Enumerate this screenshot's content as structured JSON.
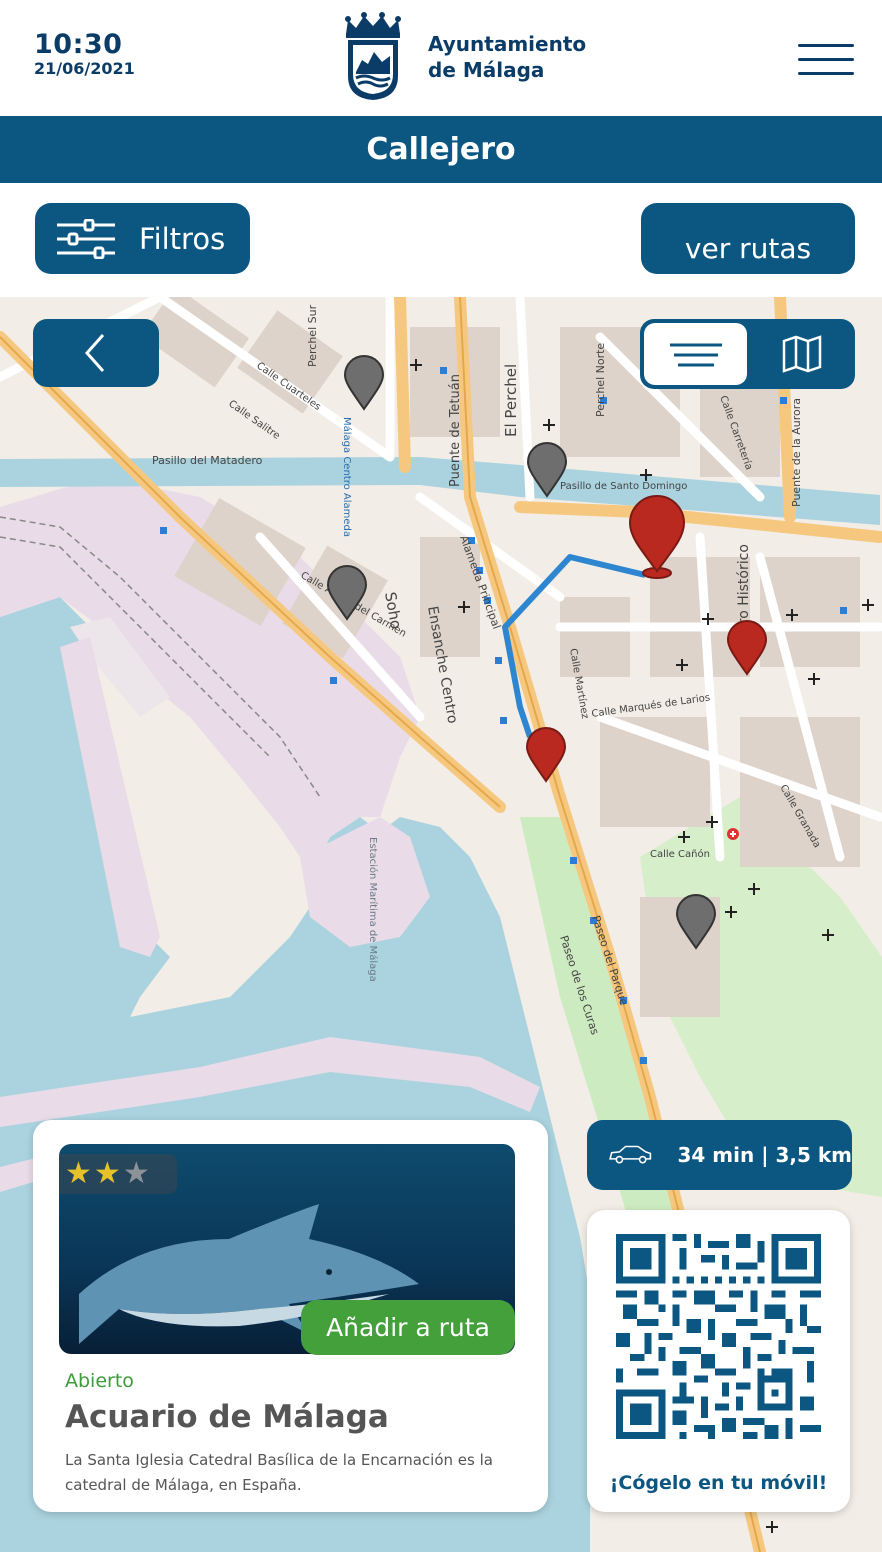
{
  "status_bar": {
    "time": "10:30",
    "date": "21/06/2021"
  },
  "header": {
    "brand_line1": "Ayuntamiento",
    "brand_line2": "de Málaga",
    "logo_icon": "malaga-coat-of-arms-icon",
    "menu_icon": "hamburger-menu-icon"
  },
  "title_bar": {
    "title": "Callejero"
  },
  "toolbar": {
    "filters_label": "Filtros",
    "filters_icon": "sliders-icon",
    "routes_label": "ver rutas"
  },
  "map_controls": {
    "back_icon": "chevron-left-icon",
    "list_view_icon": "list-icon",
    "map_view_icon": "map-icon",
    "selected_view": "list"
  },
  "map_labels": {
    "pasillo": "Pasillo del Matadero",
    "perchel_sur": "Perchel Sur",
    "el_perchel": "El Perchel",
    "perchel_norte": "Perchel Norte",
    "puente_tetuan": "Puente de Tetuán",
    "puente_aurora": "Puente de la Aurora",
    "alameda_principal": "Alameda Principal",
    "ensanche_centro": "Ensanche Centro",
    "soho": "Soho",
    "centro_historico": "Centro Histórico",
    "paseo_parque": "Paseo del Parque",
    "paseo_curas": "Paseo de los Curas",
    "estacion": "Estación Marítima de Málaga",
    "malaga_centro_alameda": "Málaga Centro Alameda",
    "calle_marques_larios": "Calle Marqués de Larios",
    "calle_granada": "Calle Granada",
    "calle_carreteria": "Calle Carretería",
    "calle_cuarteles": "Calle Cuarteles",
    "calle_salitre": "Calle Salitre",
    "calle_martinez": "Calle Martínez",
    "pasillo_santo_domingo": "Pasillo de Santo Domingo",
    "calle_ancha_carmen": "Calle Ancha del Carmen",
    "calle_canon": "Calle Cañón"
  },
  "route_info": {
    "icon": "car-icon",
    "text": "34 min | 3,5 km"
  },
  "place_card": {
    "rating": 2,
    "rating_max": 3,
    "photo_icon": "shark-photo",
    "add_button": "Añadir a ruta",
    "status": "Abierto",
    "name": "Acuario de Málaga",
    "description": "La Santa Iglesia Catedral Basílica de la Encarnación es la catedral de Málaga, en España."
  },
  "qr": {
    "icon": "qr-code-icon",
    "caption": "¡Cógelo en tu móvil!"
  },
  "colors": {
    "primary": "#0b5782",
    "header_text": "#0b3c68",
    "accent_green": "#43a03a",
    "pin_red": "#b9291f",
    "pin_gray": "#6e6e6e",
    "route_blue": "#2f86d0"
  }
}
